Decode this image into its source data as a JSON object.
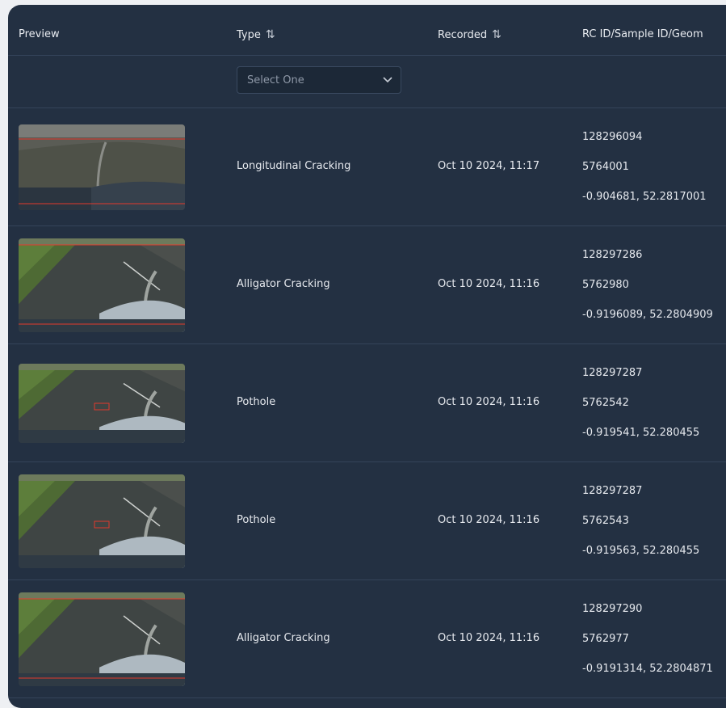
{
  "table": {
    "columns": [
      {
        "label": "Preview",
        "sortable": false
      },
      {
        "label": "Type",
        "sortable": true
      },
      {
        "label": "Recorded",
        "sortable": true
      },
      {
        "label": "RC ID/Sample ID/Geom",
        "sortable": false
      }
    ],
    "sort_glyph": "⇅",
    "type_filter": {
      "placeholder": "Select One"
    },
    "rows": [
      {
        "type": "Longitudinal Cracking",
        "recorded": "Oct 10 2024, 11:17",
        "rc_id": "128296094",
        "sample_id": "5764001",
        "geom": "-0.904681, 52.2817001",
        "scene": "flat"
      },
      {
        "type": "Alligator Cracking",
        "recorded": "Oct 10 2024, 11:16",
        "rc_id": "128297286",
        "sample_id": "5762980",
        "geom": "-0.9196089, 52.2804909",
        "scene": "road"
      },
      {
        "type": "Pothole",
        "recorded": "Oct 10 2024, 11:16",
        "rc_id": "128297287",
        "sample_id": "5762542",
        "geom": "-0.919541, 52.280455",
        "scene": "pothole"
      },
      {
        "type": "Pothole",
        "recorded": "Oct 10 2024, 11:16",
        "rc_id": "128297287",
        "sample_id": "5762543",
        "geom": "-0.919563, 52.280455",
        "scene": "pothole"
      },
      {
        "type": "Alligator Cracking",
        "recorded": "Oct 10 2024, 11:16",
        "rc_id": "128297290",
        "sample_id": "5762977",
        "geom": "-0.9191314, 52.2804871",
        "scene": "road"
      }
    ]
  },
  "colors": {
    "panel_bg": "#233042",
    "row_border": "#34435a",
    "detection_box": "#e2392d"
  }
}
